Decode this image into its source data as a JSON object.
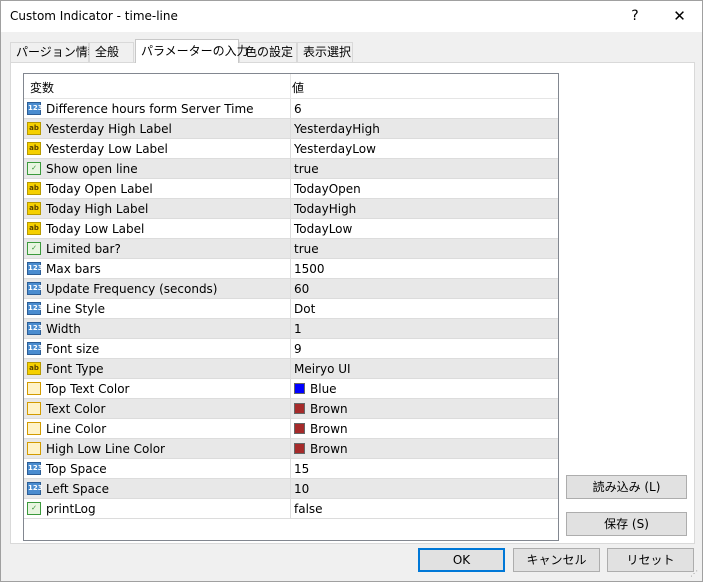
{
  "window": {
    "title": "Custom Indicator - time-line",
    "help_label": "?",
    "close_label": "✕"
  },
  "tabs": [
    "パージョン情報",
    "全般",
    "パラメーターの入力",
    "色の設定",
    "表示選択"
  ],
  "grid": {
    "header": {
      "name": "変数",
      "value": "値"
    },
    "rows": [
      {
        "icon": "number-icon",
        "name": "Difference hours form Server Time",
        "value": "6"
      },
      {
        "icon": "string-icon",
        "name": "Yesterday High Label",
        "value": "YesterdayHigh"
      },
      {
        "icon": "string-icon",
        "name": "Yesterday Low Label",
        "value": "YesterdayLow"
      },
      {
        "icon": "bool-icon",
        "name": "Show open line",
        "value": "true"
      },
      {
        "icon": "string-icon",
        "name": "Today Open Label",
        "value": "TodayOpen"
      },
      {
        "icon": "string-icon",
        "name": "Today High Label",
        "value": "TodayHigh"
      },
      {
        "icon": "string-icon",
        "name": "Today Low Label",
        "value": "TodayLow"
      },
      {
        "icon": "bool-icon",
        "name": "Limited bar?",
        "value": "true"
      },
      {
        "icon": "number-icon",
        "name": "Max bars",
        "value": "1500"
      },
      {
        "icon": "number-icon",
        "name": "Update Frequency (seconds)",
        "value": "60"
      },
      {
        "icon": "number-icon",
        "name": "Line Style",
        "value": "Dot"
      },
      {
        "icon": "number-icon",
        "name": "Width",
        "value": "1"
      },
      {
        "icon": "number-icon",
        "name": "Font size",
        "value": "9"
      },
      {
        "icon": "string-icon",
        "name": "Font Type",
        "value": "Meiryo UI"
      },
      {
        "icon": "color-icon",
        "name": "Top Text Color",
        "value": "Blue",
        "color": "#0000ff"
      },
      {
        "icon": "color-icon",
        "name": "Text Color",
        "value": "Brown",
        "color": "#a52a2a"
      },
      {
        "icon": "color-icon",
        "name": "Line Color",
        "value": "Brown",
        "color": "#a52a2a"
      },
      {
        "icon": "color-icon",
        "name": "High Low Line Color",
        "value": "Brown",
        "color": "#a52a2a"
      },
      {
        "icon": "number-icon",
        "name": "Top Space",
        "value": "15"
      },
      {
        "icon": "number-icon",
        "name": "Left Space",
        "value": "10"
      },
      {
        "icon": "bool-icon",
        "name": "printLog",
        "value": "false"
      }
    ]
  },
  "buttons": {
    "load": "読み込み (L)",
    "save": "保存 (S)",
    "ok": "OK",
    "cancel": "キャンセル",
    "reset": "リセット"
  }
}
